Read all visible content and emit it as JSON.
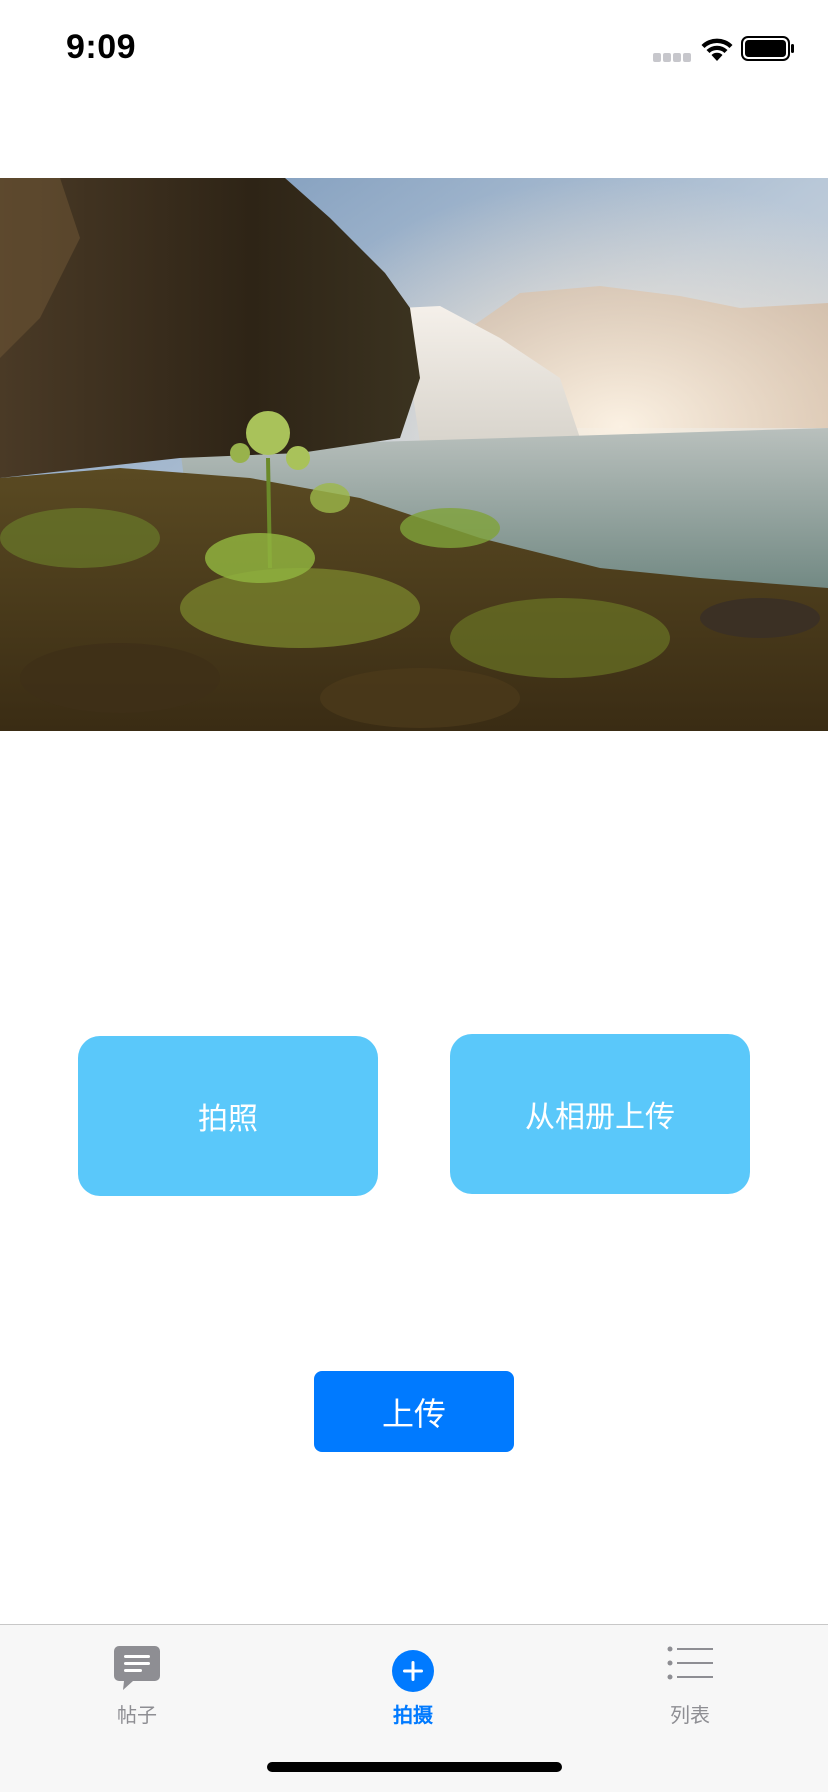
{
  "status_bar": {
    "time": "9:09",
    "icons": [
      "cellular-signal-icon",
      "wifi-icon",
      "battery-icon"
    ]
  },
  "hero": {
    "description_icon": "waterfall-landscape-photo"
  },
  "buttons": {
    "take_photo": "拍照",
    "upload_from_album": "从相册上传",
    "upload": "上传"
  },
  "tab_bar": {
    "tabs": [
      {
        "label": "帖子",
        "icon": "chat-bubble-icon",
        "selected": false
      },
      {
        "label": "拍摄",
        "icon": "plus-circle-icon",
        "selected": true
      },
      {
        "label": "列表",
        "icon": "list-icon",
        "selected": false
      }
    ]
  },
  "colors": {
    "action_button": "#5ac8fa",
    "primary": "#007aff",
    "tab_inactive": "#8e8e93",
    "tab_bar_bg": "#f7f7f7"
  }
}
